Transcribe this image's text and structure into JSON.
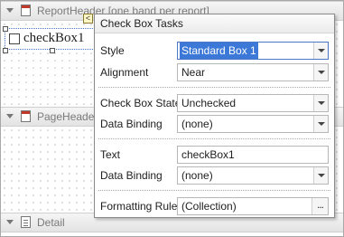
{
  "designer": {
    "bands": {
      "report_header": "ReportHeader [one band per report]",
      "page_header": "PageHeader",
      "detail": "Detail"
    },
    "control": {
      "label": "checkBox1",
      "smart_tag_glyph": "<"
    }
  },
  "tasks_panel": {
    "title": "Check Box Tasks",
    "rows": {
      "style": {
        "label": "Style",
        "value": "Standard Box 1"
      },
      "alignment": {
        "label": "Alignment",
        "value": "Near"
      },
      "check_state": {
        "label": "Check Box State",
        "value": "Unchecked"
      },
      "data_binding_1": {
        "label": "Data Binding",
        "value": "(none)"
      },
      "text": {
        "label": "Text",
        "value": "checkBox1"
      },
      "data_binding_2": {
        "label": "Data Binding",
        "value": "(none)"
      },
      "formatting_rules": {
        "label": "Formatting Rules",
        "value": "(Collection)",
        "button": "..."
      }
    }
  },
  "colors": {
    "selection": "#3c78d8",
    "panel_border": "#8a8a8a",
    "control_border": "#4a78c5"
  }
}
